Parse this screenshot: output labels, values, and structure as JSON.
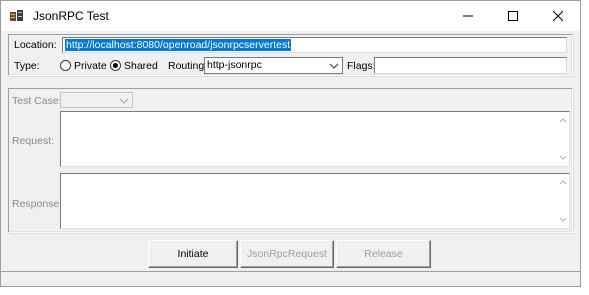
{
  "window": {
    "title": "JsonRPC Test",
    "icon": "app-icon",
    "controls": {
      "minimize": "minimize-icon",
      "maximize": "maximize-icon",
      "close": "close-icon"
    }
  },
  "connection": {
    "location_label": "Location:",
    "location_value": "http://localhost:8080/openroad/jsonrpcservertest",
    "type_label": "Type:",
    "type_options": [
      {
        "label": "Private",
        "checked": false
      },
      {
        "label": "Shared",
        "checked": true
      }
    ],
    "routing_label": "Routing:",
    "routing_value": "http-jsonrpc",
    "flags_label": "Flags:",
    "flags_value": ""
  },
  "request_panel": {
    "test_case_label": "Test Case:",
    "test_case_value": "",
    "request_label": "Request:",
    "request_value": "",
    "response_label": "Response:",
    "response_value": ""
  },
  "actions": {
    "initiate": "Initiate",
    "jsonrpc_request": "JsonRpcRequest",
    "release": "Release"
  },
  "colors": {
    "selection": "#0078d7",
    "window_bg": "#f0f0f0"
  }
}
